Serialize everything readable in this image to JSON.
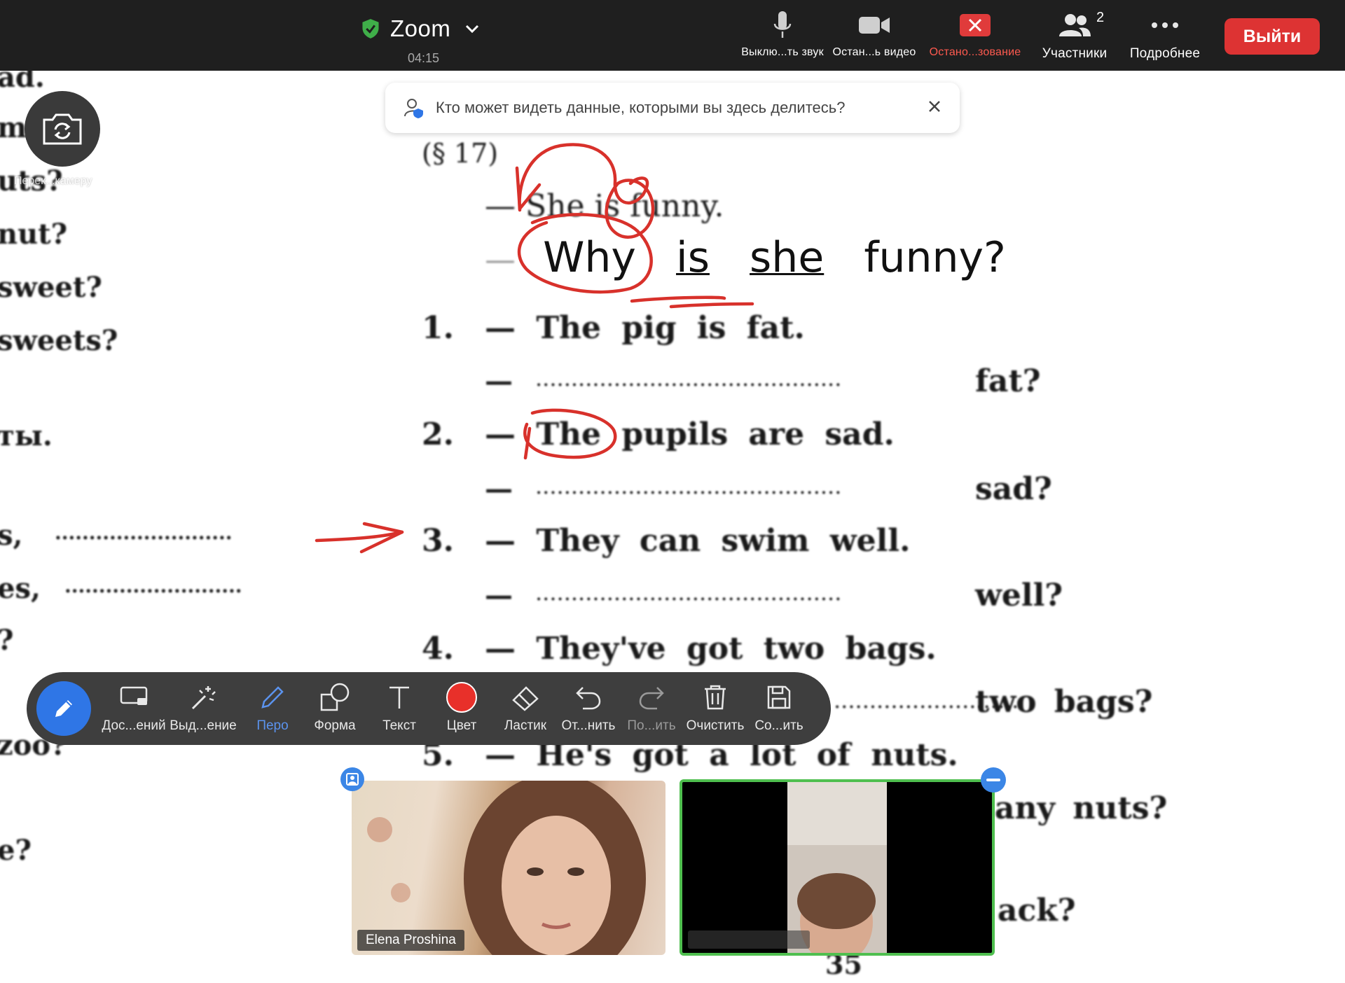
{
  "topbar": {
    "title": "Zoom",
    "timer": "04:15",
    "buttons": [
      {
        "label": "Выклю...ть звук",
        "icon": "microphone-icon"
      },
      {
        "label": "Остан...ь видео",
        "icon": "video-camera-icon"
      },
      {
        "label": "Остано...зование",
        "icon": "stop-share-icon"
      },
      {
        "label": "Участники",
        "icon": "participants-icon"
      },
      {
        "label": "Подробнее",
        "icon": "more-icon"
      }
    ],
    "participants_count": "2",
    "leave_label": "Выйти",
    "colors": {
      "bar": "#1f1f1f",
      "leave": "#dd3333",
      "stop_share": "#e03b3b",
      "shield": "#3fae49"
    }
  },
  "toast": {
    "message": "Кто может видеть данные, которыми вы здесь делитесь?"
  },
  "camera": {
    "label": "Перек...камеру"
  },
  "document": {
    "section": "(§ 17)",
    "example_statement": "— She is funny.",
    "example_question_words": [
      "Why",
      "is",
      "she",
      "funny?"
    ],
    "items": [
      {
        "num": "1.",
        "statement": "— The pig is fat.",
        "answer_end": "fat?"
      },
      {
        "num": "2.",
        "statement": "— The pupils are sad.",
        "answer_end": "sad?"
      },
      {
        "num": "3.",
        "statement": "— They can swim well.",
        "answer_end": "well?"
      },
      {
        "num": "4.",
        "statement": "— They've got two bags.",
        "answer_end": "two bags?"
      },
      {
        "num": "5.",
        "statement": "— He's got a lot of nuts.",
        "answer_end": "any nuts?"
      }
    ],
    "partial_lines": [
      "ack?"
    ],
    "page_number": "35",
    "dash": "—",
    "dots": "...........................................",
    "left_column": [
      "ad.",
      "me",
      "uts?",
      "nut?",
      "sweet?",
      "sweets?",
      "ты.",
      "s,",
      "es,",
      "?",
      "zoo?",
      "e?"
    ],
    "left_dots": "..........................",
    "annotation_color": "#d8312b"
  },
  "annotation_toolbar": {
    "tools": [
      {
        "label": "Дос...ений",
        "icon": "screen-icon"
      },
      {
        "label": "Выд...ение",
        "icon": "magic-wand-icon"
      },
      {
        "label": "Перо",
        "icon": "pen-icon",
        "active": true
      },
      {
        "label": "Форма",
        "icon": "shapes-icon"
      },
      {
        "label": "Текст",
        "icon": "text-icon"
      },
      {
        "label": "Цвет",
        "icon": "color-swatch-icon"
      },
      {
        "label": "Ластик",
        "icon": "eraser-icon"
      },
      {
        "label": "От...нить",
        "icon": "undo-icon"
      },
      {
        "label": "По...ить",
        "icon": "redo-icon"
      },
      {
        "label": "Очистить",
        "icon": "trash-icon"
      },
      {
        "label": "Со...ить",
        "icon": "save-icon"
      }
    ],
    "active_color": "#5b93ee",
    "swatch_color": "#e8302a"
  },
  "videos": [
    {
      "name": "Elena Proshina"
    },
    {
      "name": ""
    }
  ]
}
